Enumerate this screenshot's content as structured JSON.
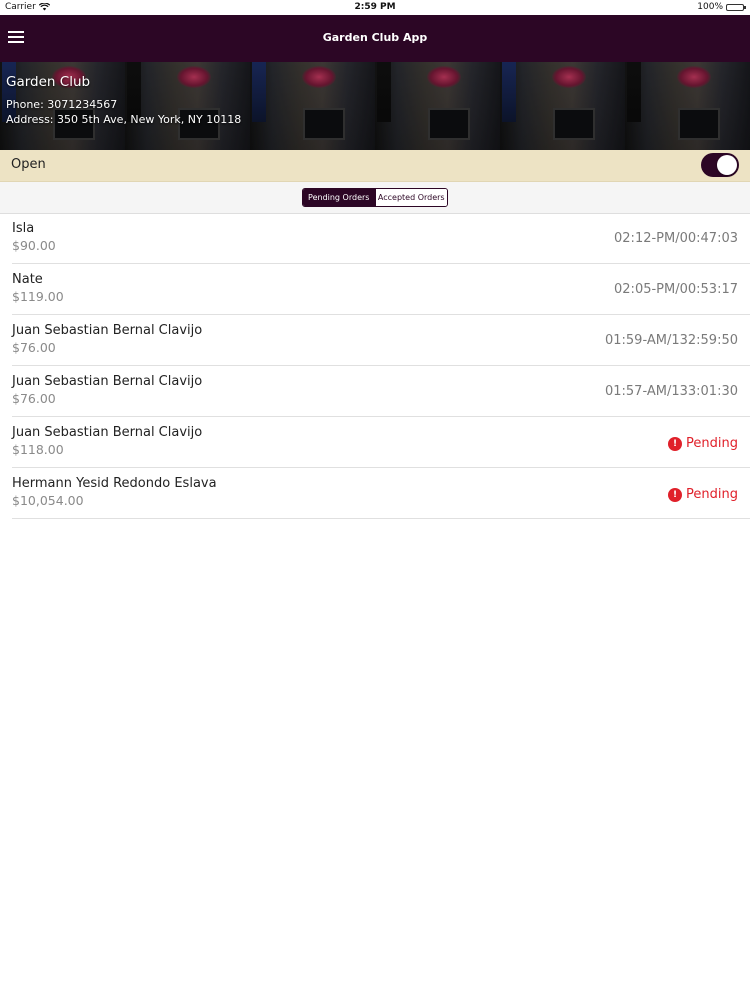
{
  "status_bar": {
    "carrier": "Carrier",
    "time": "2:59 PM",
    "battery": "100%",
    "battery_level": 1.0
  },
  "nav": {
    "title": "Garden Club App",
    "menu_icon": "hamburger-menu-icon"
  },
  "venue": {
    "name": "Garden Club",
    "phone": "Phone: 3071234567",
    "address": "Address: 350 5th Ave, New York, NY 10118"
  },
  "open_bar": {
    "label": "Open",
    "toggle_on": true
  },
  "tabs": [
    {
      "label": "Pending Orders",
      "active": true
    },
    {
      "label": "Accepted Orders",
      "active": false
    }
  ],
  "orders": [
    {
      "name": "Isla",
      "amount": "$90.00",
      "time": "02:12-PM/00:47:03"
    },
    {
      "name": "Nate",
      "amount": "$119.00",
      "time": "02:05-PM/00:53:17"
    },
    {
      "name": "Juan Sebastian Bernal Clavijo",
      "amount": "$76.00",
      "time": "01:59-AM/132:59:50"
    },
    {
      "name": "Juan Sebastian Bernal Clavijo",
      "amount": "$76.00",
      "time": "01:57-AM/133:01:30"
    },
    {
      "name": "Juan Sebastian Bernal Clavijo",
      "amount": "$118.00",
      "status": "Pending"
    },
    {
      "name": "Hermann Yesid Redondo Eslava",
      "amount": "$10,054.00",
      "status": "Pending"
    }
  ],
  "colors": {
    "primary": "#2c0625",
    "open_bar": "#ede3c4",
    "pending_status": "#e0202a",
    "battery": "#4cd964"
  }
}
